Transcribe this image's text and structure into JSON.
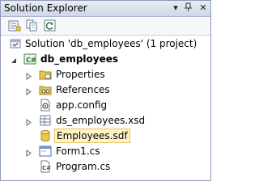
{
  "window": {
    "title": "Solution Explorer",
    "pin_glyph": "−̸",
    "dropdown_glyph": "▾",
    "close_glyph": "✕"
  },
  "toolbar": {
    "buttons": [
      {
        "name": "properties-toolbar-button",
        "icon": "properties-icon"
      },
      {
        "name": "show-all-files-button",
        "icon": "show-all-files-icon"
      },
      {
        "name": "refresh-button",
        "icon": "refresh-icon"
      }
    ]
  },
  "tree": {
    "solution": {
      "label": "Solution 'db_employees' (1 project)",
      "icon": "solution-icon"
    },
    "project": {
      "label": "db_employees",
      "icon": "csharp-project-icon",
      "expanded": true
    },
    "items": [
      {
        "label": "Properties",
        "icon": "properties-folder-icon",
        "expandable": true
      },
      {
        "label": "References",
        "icon": "references-folder-icon",
        "expandable": true
      },
      {
        "label": "app.config",
        "icon": "config-file-icon",
        "expandable": false
      },
      {
        "label": "ds_employees.xsd",
        "icon": "dataset-file-icon",
        "expandable": true
      },
      {
        "label": "Employees.sdf",
        "icon": "database-file-icon",
        "expandable": false,
        "selected": true
      },
      {
        "label": "Form1.cs",
        "icon": "form-file-icon",
        "expandable": true
      },
      {
        "label": "Program.cs",
        "icon": "csharp-file-icon",
        "expandable": false
      }
    ]
  },
  "colors": {
    "title_gradient_top": "#e8ecf4",
    "title_gradient_bottom": "#cfd6e5",
    "selection_fill": "#fff3c8",
    "selection_border": "#e5c365",
    "folder_yellow": "#e8c84a",
    "csharp_green": "#3a8a3a"
  }
}
